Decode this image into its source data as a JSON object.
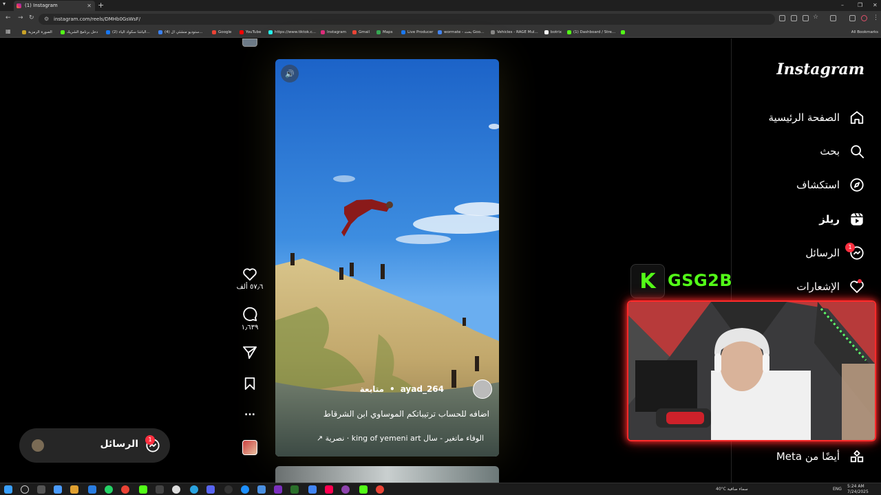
{
  "browser": {
    "tab_title": "(1) Instagram",
    "new_tab": "+",
    "url": "instagram.com/reels/DMHb0GsWsF/",
    "bookmarks": [
      {
        "label": "الصورة الرمزية",
        "color": "#c9a227"
      },
      {
        "label": "دخل برنامج الشريك",
        "color": "#53fc18"
      },
      {
        "label": "(2) الياشا سكواد الياء...",
        "color": "#1877f2"
      },
      {
        "label": "(4) ستوديو منشئي ال...",
        "color": "#3b82f6"
      },
      {
        "label": "Google",
        "color": "#ea4335"
      },
      {
        "label": "YouTube",
        "color": "#ff0000"
      },
      {
        "label": "https://www.tiktok.c...",
        "color": "#25f4ee"
      },
      {
        "label": "Instagram",
        "color": "#dd2a7b"
      },
      {
        "label": "Gmail",
        "color": "#ea4335"
      },
      {
        "label": "Maps",
        "color": "#34a853"
      },
      {
        "label": "Live Producer",
        "color": "#1877f2"
      },
      {
        "label": "wormate - بحث Goo...",
        "color": "#4285f4"
      },
      {
        "label": "Vehicles - RAGE Mul...",
        "color": "#888888"
      },
      {
        "label": "botrix",
        "color": "#ffffff"
      },
      {
        "label": "(1) Dashboard / Stre...",
        "color": "#53fc18"
      },
      {
        "label": "",
        "color": "#53fc18"
      }
    ],
    "all_bookmarks": "All Bookmarks"
  },
  "sidebar": {
    "logo": "Instagram",
    "items": [
      {
        "label": "الصفحة الرئيسية",
        "icon": "home-icon"
      },
      {
        "label": "بحث",
        "icon": "search-icon"
      },
      {
        "label": "استكشاف",
        "icon": "compass-icon"
      },
      {
        "label": "ريلز",
        "icon": "reels-icon"
      },
      {
        "label": "الرسائل",
        "icon": "messenger-icon",
        "badge": "1"
      },
      {
        "label": "الإشعارات",
        "icon": "heart-icon"
      }
    ],
    "more": {
      "label": "أيضًا من Meta",
      "icon": "grid-icon"
    }
  },
  "reel": {
    "username": "ayad_264",
    "separator": "•",
    "follow": "متابعة",
    "caption": "اضافه للحساب ترتيباتكم الموساوي ابن الشرقاط",
    "audio": "الوفاء ماتغير - سال   king of yemeni art · نصرية ↗"
  },
  "actions": {
    "likes": "٥٧٫٦ ألف",
    "comments": "١٫٦٣٩",
    "more": "..."
  },
  "messages_pill": {
    "label": "الرسائل",
    "badge": "1"
  },
  "overlay": {
    "kick_letter": "K",
    "channel": "GSG2B"
  },
  "taskbar": {
    "weather": "40°C  سماء صافية",
    "lang": "ENG",
    "time": "5:24 AM",
    "date": "7/24/2025"
  },
  "colors": {
    "kick_green": "#53fc18",
    "notification_red": "#ff3040",
    "cam_border": "#ff2a2a"
  }
}
